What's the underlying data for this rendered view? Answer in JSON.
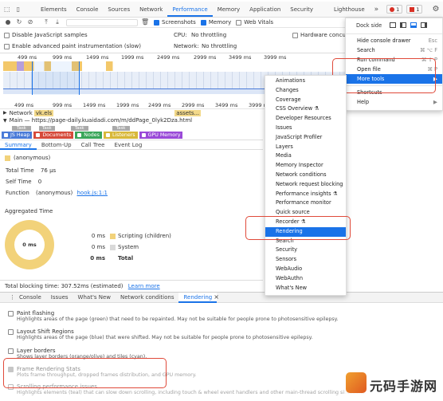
{
  "devtools": {
    "tabs": [
      "Elements",
      "Console",
      "Sources",
      "Network",
      "Performance",
      "Memory",
      "Application",
      "Security",
      "Lighthouse"
    ],
    "active_tab": "Performance",
    "more_tabs": "»",
    "error_count": "1",
    "warn_count": "1"
  },
  "toolbar": {
    "screenshots_label": "Screenshots",
    "memory_label": "Memory",
    "web_vitals_label": "Web Vitals",
    "disable_js_label": "Disable JavaScript samples",
    "cpu_label": "CPU:",
    "cpu_value": "No throttling",
    "hw_concurrency_label": "Hardware concurren",
    "advanced_paint_label": "Enable advanced paint instrumentation (slow)",
    "network_label": "Network:",
    "network_value": "No throttling"
  },
  "timeline": {
    "ticks_top": [
      "499 ms",
      "999 ms",
      "1499 ms",
      "1999 ms",
      "2499 ms",
      "2999 ms",
      "3499 ms",
      "3999 ms"
    ],
    "ticks_bottom": [
      "499 ms",
      "999 ms",
      "1499 ms",
      "1999 ms",
      "2499 ms",
      "2999 ms",
      "3499 ms",
      "3999 ms"
    ],
    "network_label": "Network",
    "network_item": "vk.els",
    "assets_item": "assets...",
    "main_label": "Main — https://page-daily.kuaidadi.com/m/ddPage_0lyk2Dza.html",
    "tasks": [
      "Task",
      "Task",
      "Task",
      "Task",
      "Task",
      "Ta",
      "Ta",
      "Task"
    ]
  },
  "legend_bar": {
    "items": [
      {
        "label": "JS Heap",
        "color": "#4a7bd8"
      },
      {
        "label": "Documents",
        "color": "#d64a3a"
      },
      {
        "label": "Nodes",
        "color": "#3aa65a"
      },
      {
        "label": "Listeners",
        "color": "#d8b83a"
      },
      {
        "label": "GPU Memory",
        "color": "#9a4ad8"
      }
    ]
  },
  "detail_tabs": [
    "Summary",
    "Bottom-Up",
    "Call Tree",
    "Event Log"
  ],
  "summary": {
    "name": "(anonymous)",
    "total_time_label": "Total Time",
    "total_time": "76 μs",
    "self_time_label": "Self Time",
    "self_time": "0",
    "function_label": "Function",
    "function_value": "(anonymous)",
    "function_link": "hook.js:1:1",
    "aggregated_title": "Aggregated Time",
    "donut_center": "0 ms",
    "rows": [
      {
        "value": "0 ms",
        "label": "Scripting (children)",
        "color": "#f2d27a"
      },
      {
        "value": "0 ms",
        "label": "System",
        "color": "#d9d9d9"
      },
      {
        "value": "0 ms",
        "label": "Total",
        "color": ""
      }
    ],
    "blocking_text": "Total blocking time: 307.52ms (estimated)",
    "learn_more": "Learn more"
  },
  "drawer": {
    "tabs": [
      "Console",
      "Issues",
      "What's New",
      "Network conditions",
      "Rendering"
    ],
    "active_tab": "Rendering",
    "close": "×",
    "items": [
      {
        "title": "Paint flashing",
        "desc": "Highlights areas of the page (green) that need to be repainted. May not be suitable for people prone to photosensitive epilepsy.",
        "checked": false
      },
      {
        "title": "Layout Shift Regions",
        "desc": "Highlights areas of the page (blue) that were shifted. May not be suitable for people prone to photosensitive epilepsy.",
        "checked": false
      },
      {
        "title": "Layer borders",
        "desc": "Shows layer borders (orange/olive) and tiles (cyan).",
        "checked": false
      },
      {
        "title": "Frame Rendering Stats",
        "desc": "Plots frame throughput, dropped frames distribution, and GPU memory.",
        "checked": true
      },
      {
        "title": "Scrolling performance issues",
        "desc": "Highlights elements (teal) that can slow down scrolling, including touch & wheel event handlers and other main-thread scrolling situations.",
        "checked": false
      }
    ]
  },
  "right_menu": {
    "dock_side": "Dock side",
    "items": [
      {
        "label": "Hide console drawer",
        "shortcut": "Esc"
      },
      {
        "label": "Search",
        "shortcut": "⌘ ⌥ F"
      },
      {
        "label": "Run command",
        "shortcut": "⌘ ⇧ P"
      },
      {
        "label": "Open file",
        "shortcut": "⌘ P"
      },
      {
        "label": "More tools",
        "shortcut": "▶"
      },
      {
        "label": "Shortcuts",
        "shortcut": ""
      },
      {
        "label": "Help",
        "shortcut": "▶"
      }
    ],
    "selected": "More tools"
  },
  "more_tools": {
    "items": [
      "Animations",
      "Changes",
      "Coverage",
      "CSS Overview ⚗",
      "Developer Resources",
      "Issues",
      "JavaScript Profiler",
      "Layers",
      "Media",
      "Memory Inspector",
      "Network conditions",
      "Network request blocking",
      "Performance insights ⚗",
      "Performance monitor",
      "Quick source",
      "Recorder ⚗",
      "Rendering",
      "Search",
      "Security",
      "Sensors",
      "WebAudio",
      "WebAuthn",
      "What's New"
    ],
    "selected": "Rendering"
  },
  "watermark": {
    "text": "元码手游网"
  },
  "colors": {
    "accent": "#1a73e8",
    "highlight_box": "#e04a3a"
  }
}
